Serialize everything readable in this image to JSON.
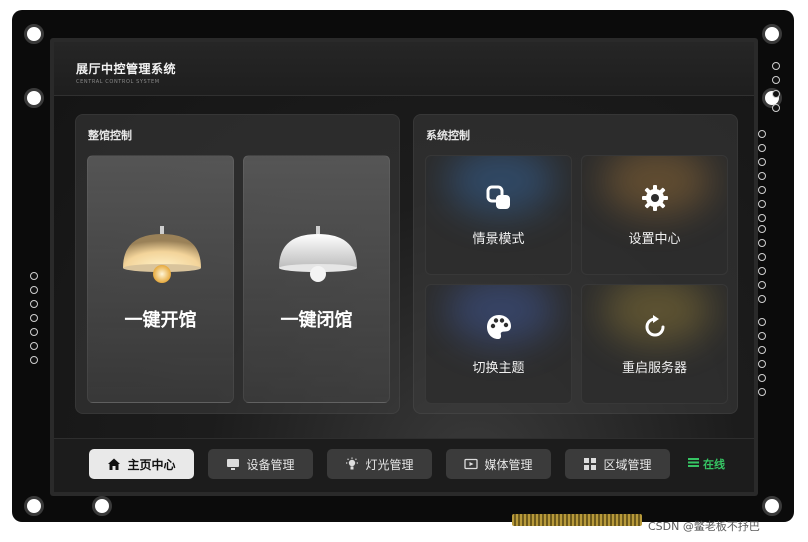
{
  "app": {
    "title": "展厅中控管理系统",
    "subtitle": "CENTRAL CONTROL SYSTEM"
  },
  "hall_panel": {
    "title": "整馆控制",
    "cards": [
      {
        "label": "一键开馆",
        "icon": "lamp-on-icon"
      },
      {
        "label": "一键闭馆",
        "icon": "lamp-off-icon"
      }
    ]
  },
  "system_panel": {
    "title": "系统控制",
    "tiles": [
      {
        "label": "情景模式",
        "icon": "scene-mode-icon"
      },
      {
        "label": "设置中心",
        "icon": "gear-icon"
      },
      {
        "label": "切换主题",
        "icon": "palette-icon"
      },
      {
        "label": "重启服务器",
        "icon": "refresh-icon"
      }
    ]
  },
  "nav": {
    "items": [
      {
        "label": "主页中心",
        "icon": "home-icon",
        "active": true
      },
      {
        "label": "设备管理",
        "icon": "monitor-icon",
        "active": false
      },
      {
        "label": "灯光管理",
        "icon": "light-icon",
        "active": false
      },
      {
        "label": "媒体管理",
        "icon": "media-icon",
        "active": false
      },
      {
        "label": "区域管理",
        "icon": "grid-icon",
        "active": false
      }
    ],
    "status": "在线"
  },
  "colors": {
    "status_online": "#36c463",
    "nav_active_bg": "#e9e9e9",
    "lamp_warm": "#f3d49a"
  },
  "watermark": "CSDN @鳖老板不抒巴"
}
